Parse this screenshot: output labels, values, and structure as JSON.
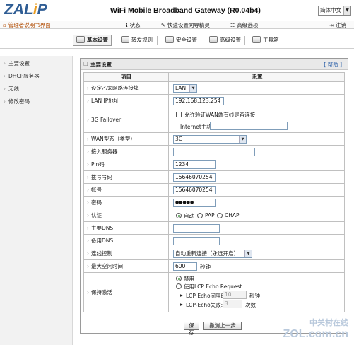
{
  "header": {
    "logo_main": "ZAL",
    "logo_i": "i",
    "logo_end": "P",
    "title": "WiFi Mobile Broadband Gateway  (R0.04b4)",
    "language": "简体中文"
  },
  "topbar": {
    "admin_manual": "管理者说明书界面",
    "status": "状态",
    "quick_wizard": "快速设置向导精灵",
    "advanced": "高级选项",
    "logout": "注销"
  },
  "tabs": [
    {
      "label": "基本设置"
    },
    {
      "label": "转发规则"
    },
    {
      "label": "安全设置"
    },
    {
      "label": "高级设置"
    },
    {
      "label": "工具箱"
    }
  ],
  "sidebar": {
    "items": [
      {
        "label": "主要设置"
      },
      {
        "label": "DHCP服务器"
      },
      {
        "label": "无线"
      },
      {
        "label": "修改密码"
      }
    ]
  },
  "panel": {
    "title": "主要设置",
    "help": "[ 帮助 ]",
    "col_item": "项目",
    "col_setting": "设置"
  },
  "form": {
    "wan_eth_label": "设定乙太网路连接埠",
    "wan_eth_value": "LAN",
    "lan_ip_label": "LAN IP地址",
    "lan_ip_value": "192.168.123.254",
    "failover_label": "3G Failover",
    "failover_check_text": "允许验证WAN端有线是否连接",
    "internet_host_label": "Internet主机:",
    "internet_host_value": "",
    "wan_type_label": "WAN型态（类型）",
    "wan_type_value": "3G",
    "apn_label": "接入服务器",
    "apn_value": "",
    "pin_label": "Pin码",
    "pin_value": "1234",
    "dial_label": "拨号号码",
    "dial_value": "15646070254",
    "account_label": "帐号",
    "account_value": "15646070254",
    "password_label": "密码",
    "password_value": "●●●●●",
    "auth_label": "认证",
    "auth_auto": "自动",
    "auth_pap": "PAP",
    "auth_chap": "CHAP",
    "dns1_label": "主要DNS",
    "dns1_value": "",
    "dns2_label": "备用DNS",
    "dns2_value": "",
    "conn_control_label": "连线控制",
    "conn_control_value": "自动重新连接（永远开启）",
    "idle_label": "最大空闲时间",
    "idle_value": "600",
    "idle_unit": "秒钟",
    "keepalive_label": "保持激活",
    "keepalive_disable": "禁用",
    "keepalive_lcp": "使用LCP Echo Request",
    "lcp_interval_label": "LCP Echo间隔时间",
    "lcp_interval_value": "10",
    "lcp_interval_unit": "秒钟",
    "lcp_fail_label": "LCP-Echo失败:",
    "lcp_fail_value": "3",
    "lcp_fail_unit": "次数"
  },
  "buttons": {
    "save": "保存",
    "undo": "撤消上一步"
  },
  "watermark": {
    "line1": "中关村在线",
    "line2": "ZOL.com.cn"
  }
}
